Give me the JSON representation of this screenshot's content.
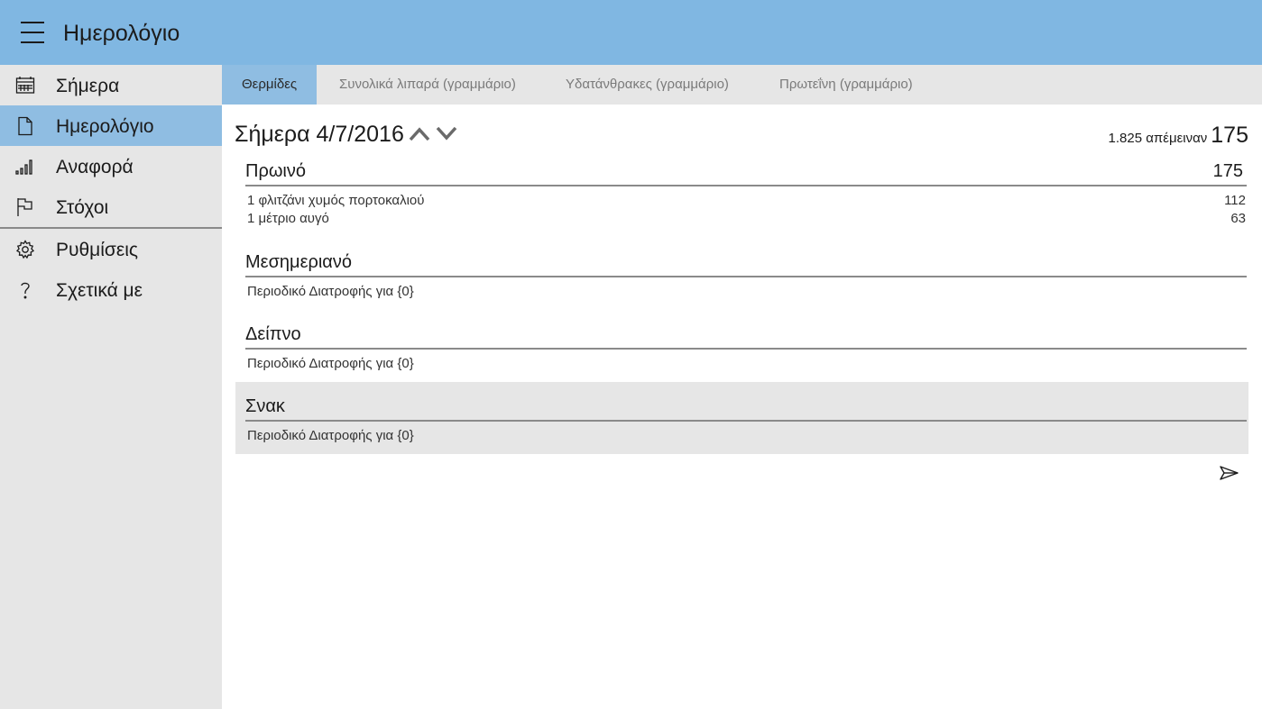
{
  "header": {
    "title": "Ημερολόγιο"
  },
  "sidebar": {
    "items": [
      {
        "label": "Σήμερα",
        "icon": "calendar-icon"
      },
      {
        "label": "Ημερολόγιο",
        "icon": "document-icon",
        "active": true
      },
      {
        "label": "Αναφορά",
        "icon": "signal-bars-icon"
      },
      {
        "label": "Στόχοι",
        "icon": "flag-icon"
      },
      {
        "label": "Ρυθμίσεις",
        "icon": "gear-icon"
      },
      {
        "label": "Σχετικά με",
        "icon": "question-icon"
      }
    ]
  },
  "tabs": [
    {
      "label": "Θερμίδες",
      "active": true
    },
    {
      "label": "Συνολικά λιπαρά (γραμμάριο)"
    },
    {
      "label": "Υδατάνθρακες (γραμμάριο)"
    },
    {
      "label": "Πρωτεΐνη (γραμμάριο)"
    }
  ],
  "day": {
    "date_label": "Σήμερα 4/7/2016",
    "remaining_label": "1.825 απέμειναν",
    "remaining_value": "175"
  },
  "meals": [
    {
      "title": "Πρωινό",
      "total": "175",
      "items": [
        {
          "name": "1 φλιτζάνι χυμός πορτοκαλιού",
          "value": "112"
        },
        {
          "name": "1 μέτριο αυγό",
          "value": "63"
        }
      ]
    },
    {
      "title": "Μεσημεριανό",
      "empty_text": "Περιοδικό Διατροφής για {0}"
    },
    {
      "title": "Δείπνο",
      "empty_text": "Περιοδικό Διατροφής για {0}"
    },
    {
      "title": "Σνακ",
      "empty_text": "Περιοδικό Διατροφής για {0}"
    }
  ],
  "colors": {
    "titlebar": "#80b7e2",
    "selected": "#8fbde2",
    "sidebar": "#e6e6e6",
    "divider": "#8a8a8a"
  }
}
